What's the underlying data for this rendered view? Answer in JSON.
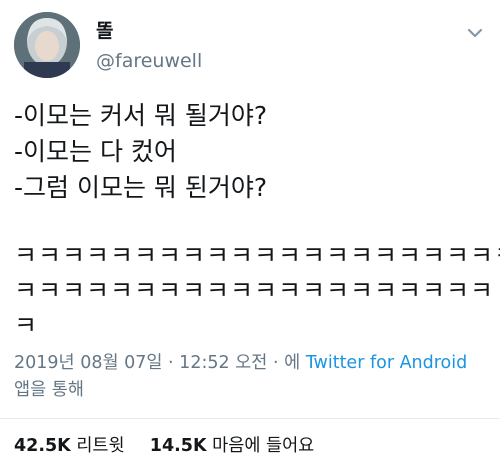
{
  "tweet": {
    "author": {
      "display_name": "똘",
      "handle": "@fareuwell",
      "avatar_icon": "avatar-portrait"
    },
    "lines": [
      "-이모는 커서 뭐 될거야?",
      "-이모는 다 컸어",
      "-그럼 이모는 뭐 된거야?"
    ],
    "laugh_lines": [
      "ㅋㅋㅋㅋㅋㅋㅋㅋㅋㅋㅋㅋㅋㅋㅋㅋㅋㅋㅋㅋㅋ",
      "ㅋㅋㅋㅋㅋㅋㅋㅋㅋㅋㅋㅋㅋㅋㅋㅋㅋㅋㅋㅋ",
      "ㅋ"
    ],
    "meta": {
      "datetime": "2019년 08월 07일 · 12:52 오전 · 에 ",
      "source": "Twitter for Android",
      "suffix": "앱을 통해"
    },
    "stats": {
      "retweets_count": "42.5K",
      "retweets_label": "리트윗",
      "likes_count": "14.5K",
      "likes_label": "마음에 들어요"
    }
  },
  "colors": {
    "text": "#14171a",
    "secondary": "#657786",
    "link": "#1b95e0",
    "divider": "#e6ecf0"
  }
}
